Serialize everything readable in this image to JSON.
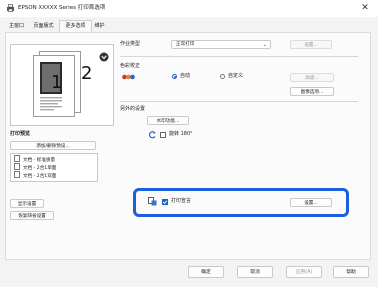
{
  "window": {
    "title": "EPSON XXXXX Series 打印首选项",
    "close_glyph": "✕"
  },
  "tabs": [
    {
      "label": "主窗口"
    },
    {
      "label": "页面版式"
    },
    {
      "label": "更多选项",
      "active": true
    },
    {
      "label": "维护"
    }
  ],
  "preview": {
    "page_numbers": [
      "1",
      "2"
    ],
    "preview_title": "打印预览",
    "settings_button": "添加/删除预设...",
    "preset_list": [
      "文档 - 标准质量",
      "文档 - 2合1单面",
      "文档 - 2合1双面"
    ]
  },
  "left_buttons": {
    "show_settings": "显示设置",
    "restore_defaults": "恢复缺省设置"
  },
  "job_type": {
    "label": "作业类型",
    "value": "正常打印",
    "settings_button": "设置..."
  },
  "color_correction": {
    "label": "色彩校正",
    "auto_label": "自动",
    "custom_label": "自定义",
    "advanced_button": "高级...",
    "image_options_button": "图像选项..."
  },
  "extra_settings": {
    "label": "另外的设置",
    "watermark_button": "水印功能...",
    "rotate_label": "旋转 180°"
  },
  "print_stamp": {
    "checkbox_label": "打印宣言",
    "settings_button": "设置..."
  },
  "footer": {
    "ok": "确定",
    "cancel": "取消",
    "apply": "应用(A)",
    "help": "帮助"
  },
  "colors": {
    "accent": "#1f5fbf",
    "highlight_border": "#1a5fe0"
  }
}
